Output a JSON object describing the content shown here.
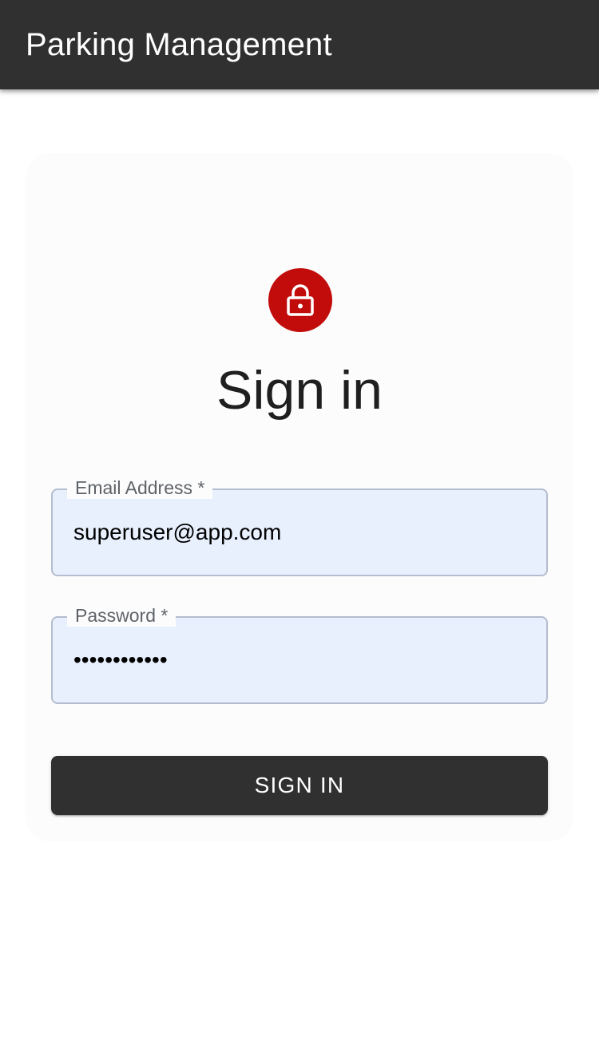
{
  "app_bar": {
    "title": "Parking Management",
    "background": "#303030"
  },
  "login": {
    "icon": "lock-icon",
    "icon_color": "#c20c0c",
    "heading": "Sign in",
    "email": {
      "label": "Email Address *",
      "value": "superuser@app.com"
    },
    "password": {
      "label": "Password *",
      "masked_value": "••••••••••••"
    },
    "submit_label": "SIGN IN"
  }
}
